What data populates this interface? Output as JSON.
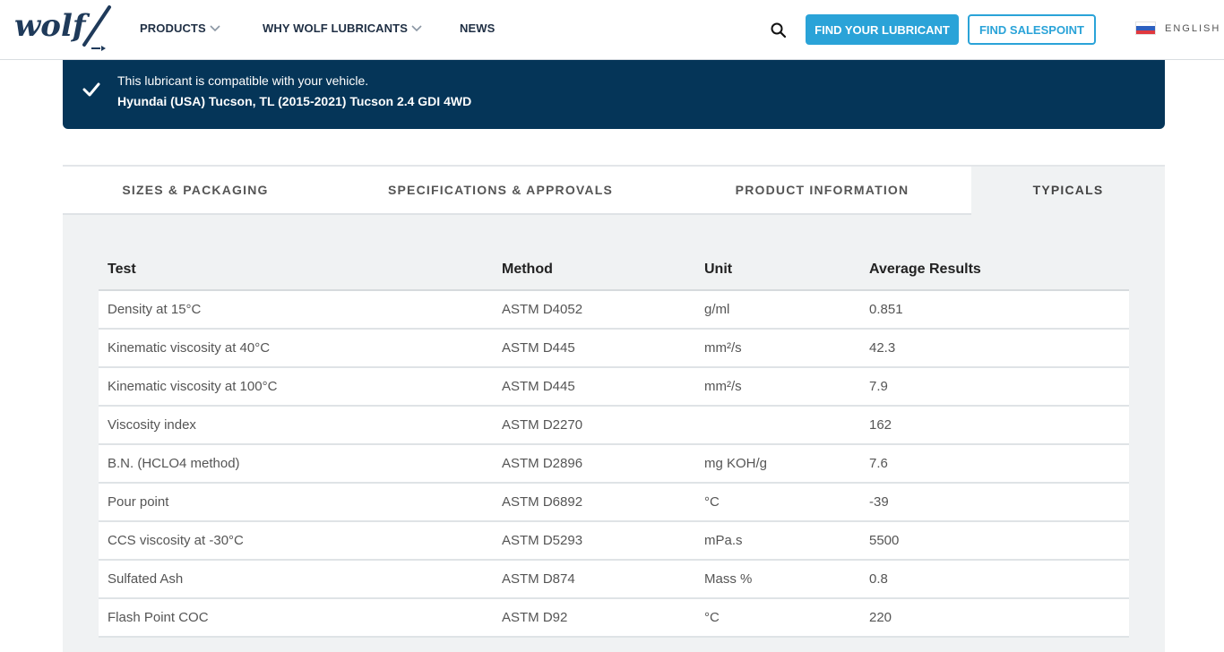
{
  "header": {
    "logo_text": "wolf",
    "nav": [
      {
        "label": "PRODUCTS",
        "has_dropdown": true
      },
      {
        "label": "WHY WOLF LUBRICANTS",
        "has_dropdown": true
      },
      {
        "label": "NEWS",
        "has_dropdown": false
      }
    ],
    "search_icon": "search-icon",
    "find_lubricant_label": "FIND YOUR LUBRICANT",
    "find_salespoint_label": "FIND SALESPOINT",
    "language_label": "ENGLISH",
    "accent_color": "#2aa3d8"
  },
  "banner": {
    "message": "This lubricant is compatible with your vehicle.",
    "vehicle": "Hyundai (USA) Tucson, TL (2015-2021) Tucson 2.4 GDI 4WD",
    "background": "#053558"
  },
  "tabs": [
    {
      "label": "SIZES & PACKAGING",
      "active": false
    },
    {
      "label": "SPECIFICATIONS & APPROVALS",
      "active": false
    },
    {
      "label": "PRODUCT INFORMATION",
      "active": false
    },
    {
      "label": "TYPICALS",
      "active": true
    }
  ],
  "typicals": {
    "headers": [
      "Test",
      "Method",
      "Unit",
      "Average Results"
    ],
    "rows": [
      [
        "Density at 15°C",
        "ASTM D4052",
        "g/ml",
        "0.851"
      ],
      [
        "Kinematic viscosity at 40°C",
        "ASTM D445",
        "mm²/s",
        "42.3"
      ],
      [
        "Kinematic viscosity at 100°C",
        "ASTM D445",
        "mm²/s",
        "7.9"
      ],
      [
        "Viscosity index",
        "ASTM D2270",
        "",
        "162"
      ],
      [
        "B.N. (HCLO4 method)",
        "ASTM D2896",
        "mg KOH/g",
        "7.6"
      ],
      [
        "Pour point",
        "ASTM D6892",
        "°C",
        "-39"
      ],
      [
        "CCS viscosity at -30°C",
        "ASTM D5293",
        "mPa.s",
        "5500"
      ],
      [
        "Sulfated Ash",
        "ASTM D874",
        "Mass %",
        "0.8"
      ],
      [
        "Flash Point COC",
        "ASTM D92",
        "°C",
        "220"
      ]
    ]
  }
}
